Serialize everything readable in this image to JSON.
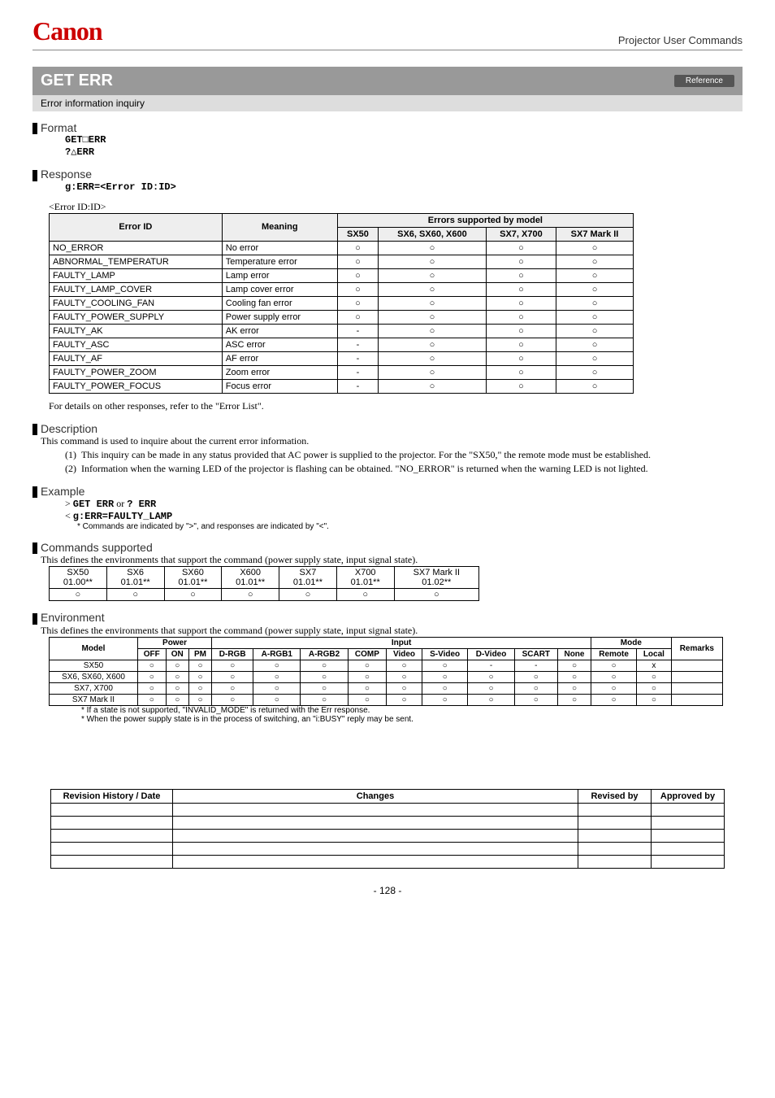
{
  "header": {
    "logo": "Canon",
    "doc_title": "Projector User Commands"
  },
  "title": {
    "command": "GET ERR",
    "badge": "Reference",
    "subtitle": "Error information inquiry"
  },
  "format": {
    "heading": "Format",
    "line1": "GET□ERR",
    "line2": "?△ERR"
  },
  "response": {
    "heading": "Response",
    "line1": "g:ERR=<Error ID:ID>",
    "table_caption": "<Error ID:ID>",
    "headers": {
      "error_id": "Error ID",
      "meaning": "Meaning",
      "top": "Errors supported by model",
      "m1": "SX50",
      "m2": "SX6, SX60, X600",
      "m3": "SX7, X700",
      "m4": "SX7 Mark II"
    },
    "rows": [
      {
        "id": "NO_ERROR",
        "meaning": "No error",
        "c": [
          "○",
          "○",
          "○",
          "○"
        ]
      },
      {
        "id": "ABNORMAL_TEMPERATUR",
        "meaning": "Temperature error",
        "c": [
          "○",
          "○",
          "○",
          "○"
        ]
      },
      {
        "id": "FAULTY_LAMP",
        "meaning": "Lamp error",
        "c": [
          "○",
          "○",
          "○",
          "○"
        ]
      },
      {
        "id": "FAULTY_LAMP_COVER",
        "meaning": "Lamp cover error",
        "c": [
          "○",
          "○",
          "○",
          "○"
        ]
      },
      {
        "id": "FAULTY_COOLING_FAN",
        "meaning": "Cooling fan error",
        "c": [
          "○",
          "○",
          "○",
          "○"
        ]
      },
      {
        "id": "FAULTY_POWER_SUPPLY",
        "meaning": "Power supply error",
        "c": [
          "○",
          "○",
          "○",
          "○"
        ]
      },
      {
        "id": "FAULTY_AK",
        "meaning": "AK error",
        "c": [
          "-",
          "○",
          "○",
          "○"
        ]
      },
      {
        "id": "FAULTY_ASC",
        "meaning": "ASC error",
        "c": [
          "-",
          "○",
          "○",
          "○"
        ]
      },
      {
        "id": "FAULTY_AF",
        "meaning": "AF error",
        "c": [
          "-",
          "○",
          "○",
          "○"
        ]
      },
      {
        "id": "FAULTY_POWER_ZOOM",
        "meaning": "Zoom error",
        "c": [
          "-",
          "○",
          "○",
          "○"
        ]
      },
      {
        "id": "FAULTY_POWER_FOCUS",
        "meaning": "Focus error",
        "c": [
          "-",
          "○",
          "○",
          "○"
        ]
      }
    ],
    "note": "For details on other responses, refer to the \"Error List\"."
  },
  "description": {
    "heading": "Description",
    "intro": "This command is used to inquire about the current error information.",
    "items": [
      "This inquiry can be made in any status provided that AC power is supplied to the projector. For the \"SX50,\" the remote mode must be established.",
      "Information when the warning LED of the projector is flashing can be obtained. \"NO_ERROR\" is returned when the warning LED is not lighted."
    ]
  },
  "example": {
    "heading": "Example",
    "line1a": "> ",
    "line1b": "GET ERR",
    "line1c": " or ",
    "line1d": "? ERR",
    "line2a": "< ",
    "line2b": "g:ERR=FAULTY_LAMP",
    "note": "*  Commands are indicated by \">\", and responses are indicated by \"<\"."
  },
  "commands": {
    "heading": "Commands supported",
    "intro": "This defines the environments that support the command (power supply state, input signal state).",
    "head": [
      "SX50",
      "SX6",
      "SX60",
      "X600",
      "SX7",
      "X700",
      "SX7 Mark II"
    ],
    "ver": [
      "01.00**",
      "01.01**",
      "01.01**",
      "01.01**",
      "01.01**",
      "01.01**",
      "01.02**"
    ],
    "supp": [
      "○",
      "○",
      "○",
      "○",
      "○",
      "○",
      "○"
    ]
  },
  "environment": {
    "heading": "Environment",
    "intro": "This defines the environments that support the command (power supply state, input signal state).",
    "head": {
      "model": "Model",
      "power": "Power",
      "input": "Input",
      "mode": "Mode",
      "remarks": "Remarks",
      "off": "OFF",
      "on": "ON",
      "pm": "PM",
      "drgb": "D-RGB",
      "argb1": "A-RGB1",
      "argb2": "A-RGB2",
      "comp": "COMP",
      "video": "Video",
      "svideo": "S-Video",
      "dvideo": "D-Video",
      "scart": "SCART",
      "none": "None",
      "remote": "Remote",
      "local": "Local"
    },
    "rows": [
      {
        "model": "SX50",
        "c": [
          "○",
          "○",
          "○",
          "○",
          "○",
          "○",
          "○",
          "○",
          "○",
          "-",
          "-",
          "○",
          "○",
          "x",
          ""
        ]
      },
      {
        "model": "SX6, SX60, X600",
        "c": [
          "○",
          "○",
          "○",
          "○",
          "○",
          "○",
          "○",
          "○",
          "○",
          "○",
          "○",
          "○",
          "○",
          "○",
          ""
        ]
      },
      {
        "model": "SX7, X700",
        "c": [
          "○",
          "○",
          "○",
          "○",
          "○",
          "○",
          "○",
          "○",
          "○",
          "○",
          "○",
          "○",
          "○",
          "○",
          ""
        ]
      },
      {
        "model": "SX7 Mark II",
        "c": [
          "○",
          "○",
          "○",
          "○",
          "○",
          "○",
          "○",
          "○",
          "○",
          "○",
          "○",
          "○",
          "○",
          "○",
          ""
        ]
      }
    ],
    "foot1": "*  If a state is not supported, \"INVALID_MODE\" is returned with the Err response.",
    "foot2": "*  When the power supply state is in the process of switching, an \"i:BUSY\" reply may be sent."
  },
  "revision": {
    "headers": [
      "Revision History / Date",
      "Changes",
      "Revised by",
      "Approved by"
    ]
  },
  "page_num": "- 128 -"
}
